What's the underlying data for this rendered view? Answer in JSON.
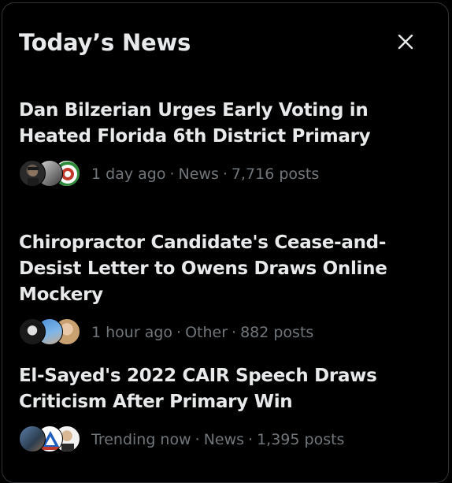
{
  "panel": {
    "title": "Today’s News"
  },
  "news": [
    {
      "headline": "Dan Bilzerian Urges Early Voting in Heated Florida 6th District Primary",
      "time": "1 day ago",
      "category": "News",
      "posts": "7,716 posts"
    },
    {
      "headline": "Chiropractor Candidate's Cease-and-Desist Letter to Owens Draws Online Mockery",
      "time": "1 hour ago",
      "category": "Other",
      "posts": "882 posts"
    },
    {
      "headline": "El-Sayed's 2022 CAIR Speech Draws Criticism After Primary Win",
      "time": "Trending now",
      "category": "News",
      "posts": "1,395 posts"
    }
  ],
  "meta_separator": "·",
  "colors": {
    "background": "#000000",
    "text_primary": "#e7e9ea",
    "text_secondary": "#71767b",
    "border": "#2f3336"
  },
  "icons": {
    "close": "close-icon"
  }
}
